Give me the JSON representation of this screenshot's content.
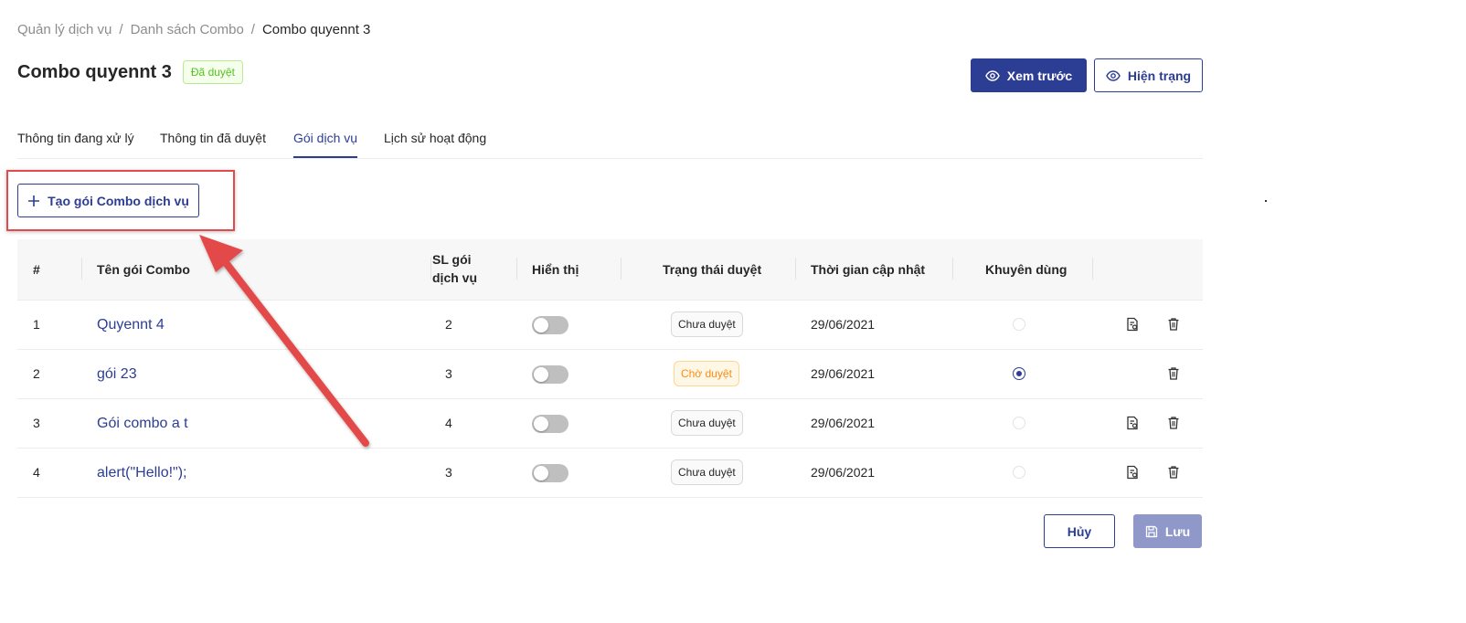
{
  "breadcrumb": {
    "items": [
      "Quản lý dịch vụ",
      "Danh sách Combo",
      "Combo quyennt 3"
    ],
    "separator": "/"
  },
  "header": {
    "title": "Combo quyennt 3",
    "status": "Đã duyệt",
    "preview_label": "Xem trước",
    "current_label": "Hiện trạng"
  },
  "tabs": [
    {
      "label": "Thông tin đang xử lý",
      "active": false
    },
    {
      "label": "Thông tin đã duyệt",
      "active": false
    },
    {
      "label": "Gói dịch vụ",
      "active": true
    },
    {
      "label": "Lịch sử hoạt động",
      "active": false
    }
  ],
  "create_button_label": "Tạo gói Combo dịch vụ",
  "table": {
    "columns": [
      "#",
      "Tên gói Combo",
      "SL gói dịch vụ",
      "Hiển thị",
      "Trạng thái duyệt",
      "Thời gian cập nhật",
      "Khuyên dùng"
    ],
    "rows": [
      {
        "index": "1",
        "name": "Quyennt 4",
        "count": "2",
        "visible": false,
        "status": "Chưa duyệt",
        "status_kind": "gray",
        "updated": "29/06/2021",
        "recommended": false,
        "has_edit": true
      },
      {
        "index": "2",
        "name": "gói 23",
        "count": "3",
        "visible": false,
        "status": "Chờ duyệt",
        "status_kind": "orange",
        "updated": "29/06/2021",
        "recommended": true,
        "has_edit": false
      },
      {
        "index": "3",
        "name": "Gói combo a t",
        "count": "4",
        "visible": false,
        "status": "Chưa duyệt",
        "status_kind": "gray",
        "updated": "29/06/2021",
        "recommended": false,
        "has_edit": true
      },
      {
        "index": "4",
        "name": "alert(\"Hello!\");",
        "count": "3",
        "visible": false,
        "status": "Chưa duyệt",
        "status_kind": "gray",
        "updated": "29/06/2021",
        "recommended": false,
        "has_edit": true
      }
    ]
  },
  "footer": {
    "cancel_label": "Hủy",
    "save_label": "Lưu"
  },
  "colors": {
    "primary": "#2c3d94",
    "annotation": "#e34a4a"
  }
}
